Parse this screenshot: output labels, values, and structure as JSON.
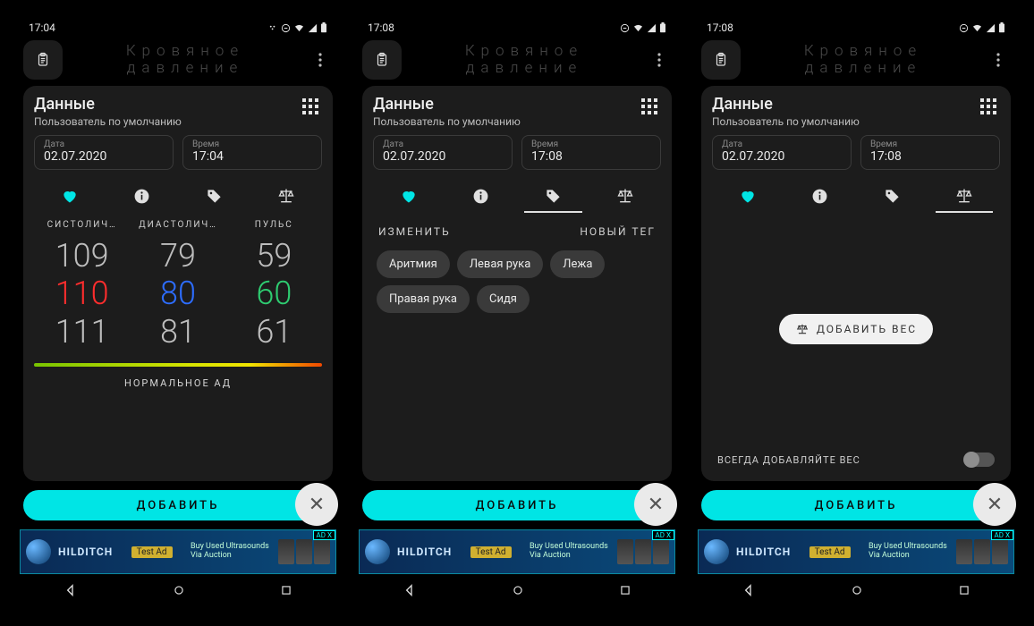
{
  "app_title_l1": "Кровяное",
  "app_title_l2": "давление",
  "panel_title": "Данные",
  "panel_subtitle": "Пользователь по умолчанию",
  "date_label": "Дата",
  "time_label": "Время",
  "date_value": "02.07.2020",
  "add_label": "ДОБАВИТЬ",
  "s1": {
    "clock": "17:04",
    "time_value": "17:04",
    "col_sys": "СИСТОЛИЧ…",
    "col_dia": "ДИАСТОЛИЧ…",
    "col_pulse": "ПУЛЬС",
    "sys": [
      "109",
      "110",
      "111"
    ],
    "dia": [
      "79",
      "80",
      "81"
    ],
    "pulse": [
      "59",
      "60",
      "61"
    ],
    "gauge": "НОРМАЛЬНОЕ АД"
  },
  "s2": {
    "clock": "17:08",
    "time_value": "17:08",
    "edit": "ИЗМЕНИТЬ",
    "new_tag": "НОВЫЙ ТЕГ",
    "tags": [
      "Аритмия",
      "Левая рука",
      "Лежа",
      "Правая рука",
      "Сидя"
    ]
  },
  "s3": {
    "clock": "17:08",
    "time_value": "17:08",
    "add_weight": "ДОБАВИТЬ ВЕС",
    "always": "ВСЕГДА ДОБАВЛЯЙТЕ ВЕС"
  },
  "ad": {
    "brand": "HILDITCH",
    "badge": "Test Ad",
    "label": "AD X",
    "txt": "Buy Used Ultrasounds Via Auction"
  }
}
